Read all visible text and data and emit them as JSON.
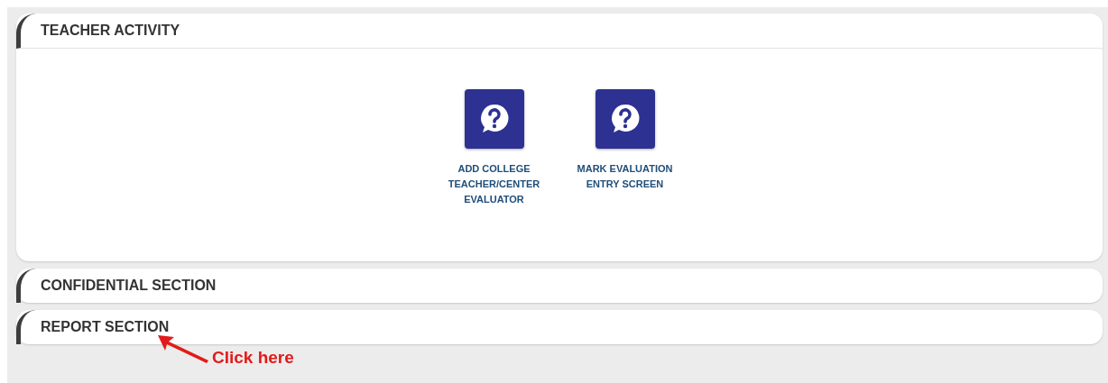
{
  "sections": [
    {
      "title": "TEACHER ACTIVITY",
      "expanded": true,
      "tiles": [
        {
          "label": "ADD COLLEGE TEACHER/CENTER EVALUATOR"
        },
        {
          "label": "MARK EVALUATION ENTRY SCREEN"
        }
      ]
    },
    {
      "title": "CONFIDENTIAL SECTION",
      "expanded": false
    },
    {
      "title": "REPORT SECTION",
      "expanded": false
    }
  ],
  "annotation": {
    "text": "Click here"
  }
}
